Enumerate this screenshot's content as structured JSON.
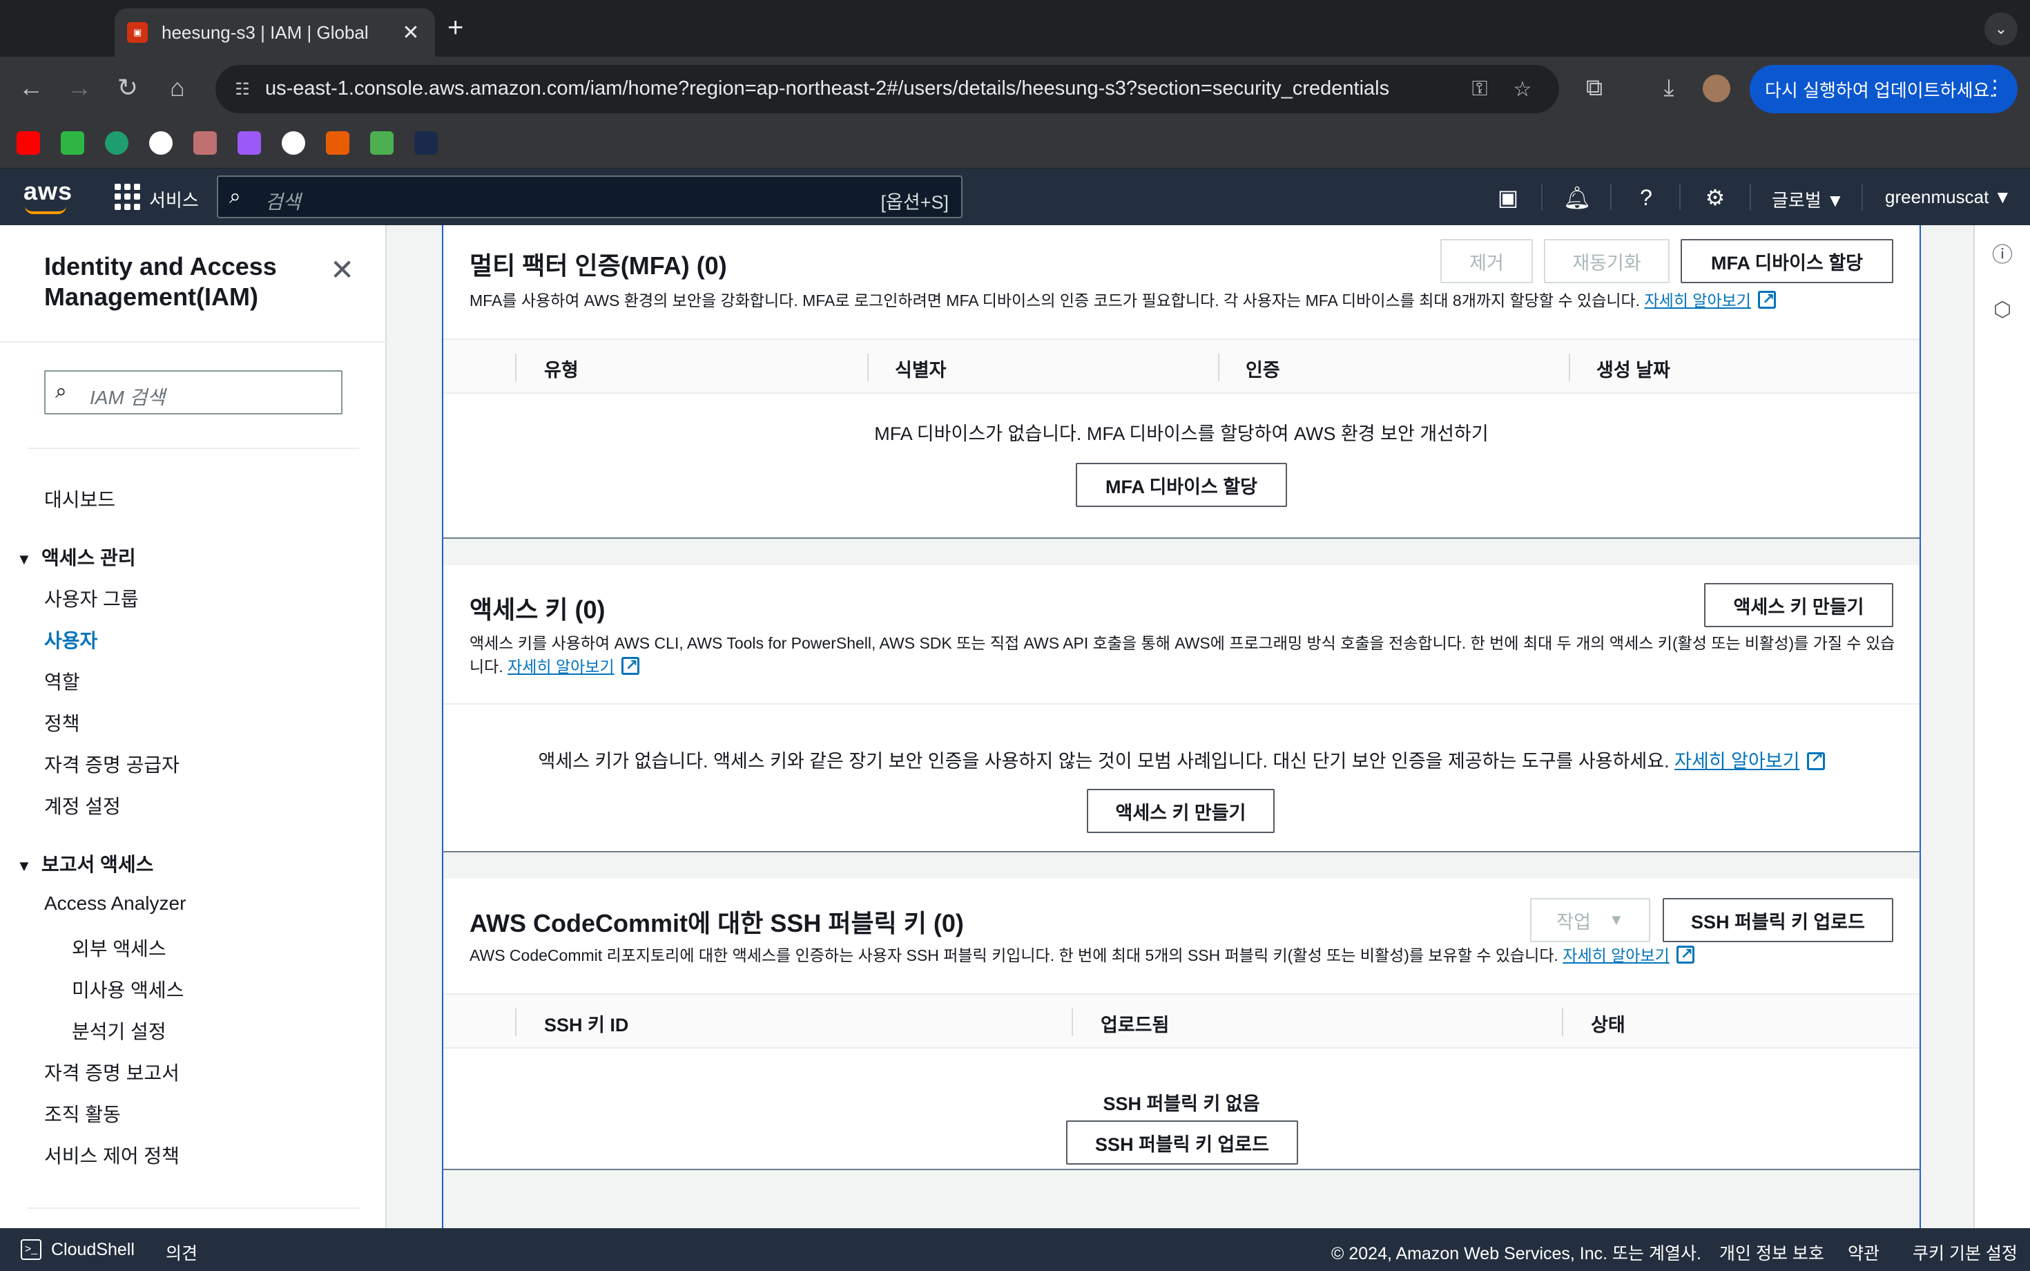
{
  "browser": {
    "tab_title": "heesung-s3 | IAM | Global",
    "tab_favicon": "aws-icon",
    "url": "us-east-1.console.aws.amazon.com/iam/home?region=ap-northeast-2#/users/details/heesung-s3?section=security_credentials",
    "update_button": "다시 실행하여 업데이트하세요.",
    "bookmarks": [
      {
        "name": "youtube-icon",
        "color": "#ff0000"
      },
      {
        "name": "notion-n-icon",
        "color": "#2db742"
      },
      {
        "name": "extension-icon",
        "color": "#1e9e6e"
      },
      {
        "name": "github-icon",
        "color": "#ffffff"
      },
      {
        "name": "photo-icon",
        "color": "#c07070"
      },
      {
        "name": "cube-icon",
        "color": "#9b59f5"
      },
      {
        "name": "openai-icon",
        "color": "#ffffff"
      },
      {
        "name": "w-icon",
        "color": "#e85d04"
      },
      {
        "name": "ac-icon",
        "color": "#4caf50"
      },
      {
        "name": "bird-icon",
        "color": "#1a2a4a"
      }
    ]
  },
  "aws_nav": {
    "logo": "aws",
    "services": "서비스",
    "search_placeholder": "검색",
    "search_shortcut": "[옵션+S]",
    "region": "글로벌 ▼",
    "account": "greenmuscat ▼"
  },
  "sidebar": {
    "title": "Identity and Access Management(IAM)",
    "search_placeholder": "IAM 검색",
    "dashboard": "대시보드",
    "section_access": "액세스 관리",
    "access_items": [
      "사용자 그룹",
      "사용자",
      "역할",
      "정책",
      "자격 증명 공급자",
      "계정 설정"
    ],
    "active_item": "사용자",
    "section_reports": "보고서 액세스",
    "reports_items": [
      "Access Analyzer",
      "외부 액세스",
      "미사용 액세스",
      "분석기 설정",
      "자격 증명 보고서",
      "조직 활동",
      "서비스 제어 정책"
    ]
  },
  "mfa": {
    "title": "멀티 팩터 인증(MFA) (0)",
    "btn_remove": "제거",
    "btn_resync": "재동기화",
    "btn_assign": "MFA 디바이스 할당",
    "desc": "MFA를 사용하여 AWS 환경의 보안을 강화합니다. MFA로 로그인하려면 MFA 디바이스의 인증 코드가 필요합니다. 각 사용자는 MFA 디바이스를 최대 8개까지 할당할 수 있습니다.",
    "learn_more": "자세히 알아보기",
    "columns": [
      "유형",
      "식별자",
      "인증",
      "생성 날짜"
    ],
    "empty": "MFA 디바이스가 없습니다. MFA 디바이스를 할당하여 AWS 환경 보안 개선하기",
    "empty_button": "MFA 디바이스 할당"
  },
  "access_keys": {
    "title": "액세스 키 (0)",
    "btn_create": "액세스 키 만들기",
    "desc": "액세스 키를 사용하여 AWS CLI, AWS Tools for PowerShell, AWS SDK 또는 직접 AWS API 호출을 통해 AWS에 프로그래밍 방식 호출을 전송합니다. 한 번에 최대 두 개의 액세스 키(활성 또는 비활성)를 가질 수 있습니다.",
    "learn_more": "자세히 알아보기",
    "empty": "액세스 키가 없습니다. 액세스 키와 같은 장기 보안 인증을 사용하지 않는 것이 모범 사례입니다. 대신 단기 보안 인증을 제공하는 도구를 사용하세요.",
    "empty_learn_more": "자세히 알아보기",
    "empty_button": "액세스 키 만들기"
  },
  "ssh": {
    "title": "AWS CodeCommit에 대한 SSH 퍼블릭 키 (0)",
    "btn_actions": "작업",
    "btn_upload": "SSH 퍼블릭 키 업로드",
    "desc": "AWS CodeCommit 리포지토리에 대한 액세스를 인증하는 사용자 SSH 퍼블릭 키입니다. 한 번에 최대 5개의 SSH 퍼블릭 키(활성 또는 비활성)를 보유할 수 있습니다.",
    "learn_more": "자세히 알아보기",
    "columns": [
      "SSH 키 ID",
      "업로드됨",
      "상태"
    ],
    "empty": "SSH 퍼블릭 키 없음",
    "empty_button": "SSH 퍼블릭 키 업로드"
  },
  "footer": {
    "cloudshell": "CloudShell",
    "feedback": "의견",
    "copyright": "© 2024, Amazon Web Services, Inc. 또는 계열사.",
    "privacy": "개인 정보 보호",
    "terms": "약관",
    "cookies": "쿠키 기본 설정"
  }
}
